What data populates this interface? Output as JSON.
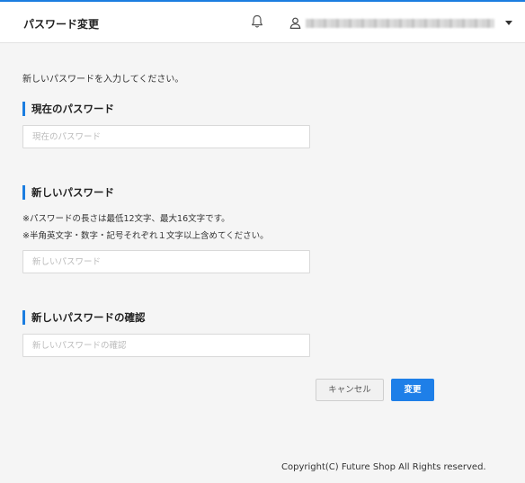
{
  "header": {
    "title": "パスワード変更",
    "user_name": "",
    "accent_color": "#1b7de0"
  },
  "form": {
    "intro": "新しいパスワードを入力してください。",
    "current": {
      "label": "現在のパスワード",
      "placeholder": "現在のパスワード"
    },
    "new": {
      "label": "新しいパスワード",
      "note1": "※パスワードの長さは最低12文字、最大16文字です。",
      "note2": "※半角英文字・数字・記号それぞれ１文字以上含めてください。",
      "placeholder": "新しいパスワード"
    },
    "confirm": {
      "label": "新しいパスワードの確認",
      "placeholder": "新しいパスワードの確認"
    },
    "cancel_label": "キャンセル",
    "submit_label": "変更"
  },
  "footer": {
    "copyright": "Copyright(C) Future Shop All Rights reserved."
  }
}
